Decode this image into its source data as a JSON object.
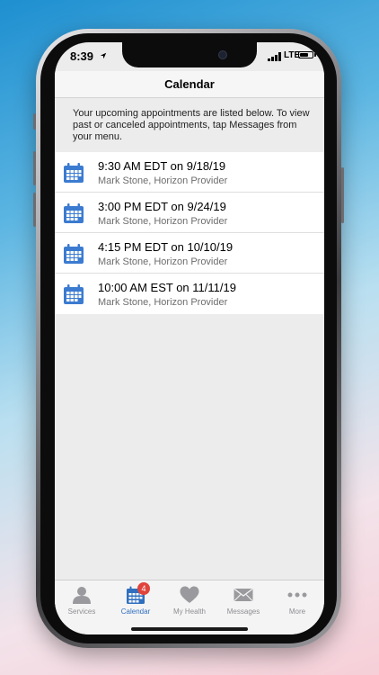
{
  "status_bar": {
    "time": "8:39",
    "network": "LTE",
    "battery_level": 0.7
  },
  "header": {
    "title": "Calendar"
  },
  "info_text": "Your upcoming appointments are listed below. To view past or canceled appointments, tap Messages from your menu.",
  "appointments": [
    {
      "datetime": "9:30 AM EDT on 9/18/19",
      "provider": "Mark Stone, Horizon Provider",
      "icon": "calendar-icon"
    },
    {
      "datetime": "3:00 PM EDT on 9/24/19",
      "provider": "Mark Stone, Horizon Provider",
      "icon": "calendar-icon"
    },
    {
      "datetime": "4:15 PM EDT on 10/10/19",
      "provider": "Mark Stone, Horizon Provider",
      "icon": "calendar-icon"
    },
    {
      "datetime": "10:00 AM EST on 11/11/19",
      "provider": "Mark Stone, Horizon Provider",
      "icon": "calendar-icon"
    }
  ],
  "tabs": [
    {
      "label": "Services",
      "icon": "person-icon",
      "active": false
    },
    {
      "label": "Calendar",
      "icon": "calendar-icon",
      "active": true,
      "badge": "4"
    },
    {
      "label": "My Health",
      "icon": "heart-icon",
      "active": false
    },
    {
      "label": "Messages",
      "icon": "envelope-icon",
      "active": false
    },
    {
      "label": "More",
      "icon": "more-dots-icon",
      "active": false
    }
  ],
  "colors": {
    "accent": "#2f6fbf",
    "badge": "#e0443a",
    "calendar_icon": "#3b7bd0"
  }
}
